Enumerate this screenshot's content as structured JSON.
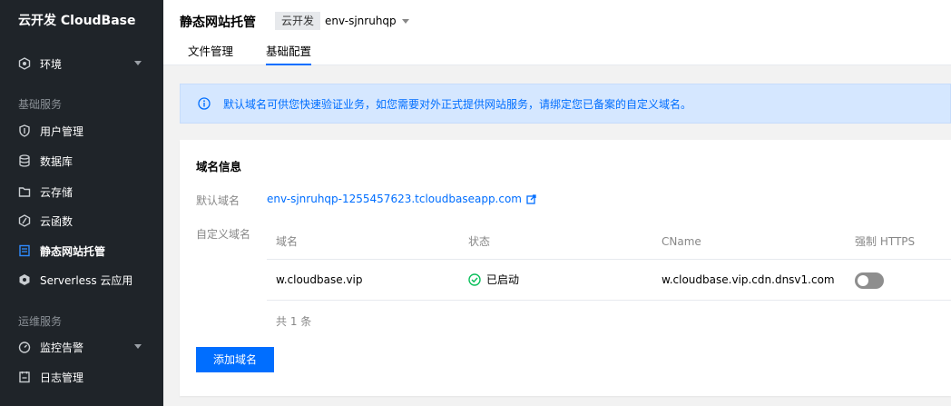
{
  "sidebar": {
    "brand": "云开发 CloudBase",
    "env_item": "环境",
    "section_basic": "基础服务",
    "items": [
      {
        "label": "用户管理",
        "icon": "shield-icon"
      },
      {
        "label": "数据库",
        "icon": "database-icon"
      },
      {
        "label": "云存储",
        "icon": "folder-icon"
      },
      {
        "label": "云函数",
        "icon": "function-icon"
      },
      {
        "label": "静态网站托管",
        "icon": "web-hosting-icon",
        "active": true
      },
      {
        "label": "Serverless 云应用",
        "icon": "hexagon-icon"
      }
    ],
    "section_ops": "运维服务",
    "ops_items": [
      {
        "label": "监控告警",
        "icon": "monitor-icon"
      },
      {
        "label": "日志管理",
        "icon": "log-icon"
      }
    ]
  },
  "header": {
    "title": "静态网站托管",
    "env_chip": "云开发",
    "env_name": "env-sjnruhqp",
    "tabs": [
      {
        "label": "文件管理"
      },
      {
        "label": "基础配置",
        "active": true
      }
    ]
  },
  "notice": {
    "text": "默认域名可供您快速验证业务，如您需要对外正式提供网站服务，请绑定您已备案的自定义域名。"
  },
  "card": {
    "title": "域名信息",
    "default_domain_label": "默认域名",
    "default_domain": "env-sjnruhqp-1255457623.tcloudbaseapp.com",
    "custom_domain_label": "自定义域名",
    "table": {
      "headers": [
        "域名",
        "状态",
        "CName",
        "强制 HTTPS"
      ],
      "rows": [
        {
          "domain": "w.cloudbase.vip",
          "status": "已启动",
          "cname": "w.cloudbase.vip.cdn.dnsv1.com"
        }
      ],
      "total": "共 1 条"
    },
    "add_button": "添加域名"
  },
  "colors": {
    "accent": "#006eff",
    "sidebar_bg": "#1f2429",
    "status_ok": "#0abf5b"
  }
}
